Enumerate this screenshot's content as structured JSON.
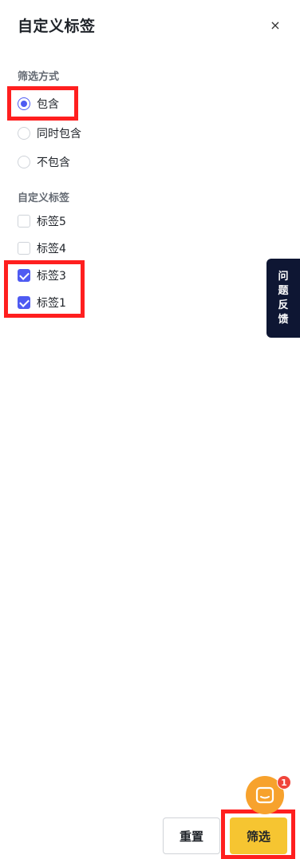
{
  "dialog": {
    "title": "自定义标签",
    "close_label": "×"
  },
  "filter_mode": {
    "label": "筛选方式",
    "options": [
      {
        "label": "包含",
        "checked": true
      },
      {
        "label": "同时包含",
        "checked": false
      },
      {
        "label": "不包含",
        "checked": false
      }
    ]
  },
  "custom_tags": {
    "label": "自定义标签",
    "options": [
      {
        "label": "标签5",
        "checked": false
      },
      {
        "label": "标签4",
        "checked": false
      },
      {
        "label": "标签3",
        "checked": true
      },
      {
        "label": "标签1",
        "checked": true
      }
    ]
  },
  "feedback": {
    "chars": [
      "问",
      "题",
      "反",
      "馈"
    ]
  },
  "chat": {
    "badge_count": "1"
  },
  "actions": {
    "reset_label": "重置",
    "filter_label": "筛选"
  },
  "colors": {
    "accent": "#4e5bf2",
    "primary_button": "#f6c531",
    "highlight": "#ff1f1f",
    "feedback_tab": "#0e1633",
    "chat_fab": "#f7a22d"
  }
}
